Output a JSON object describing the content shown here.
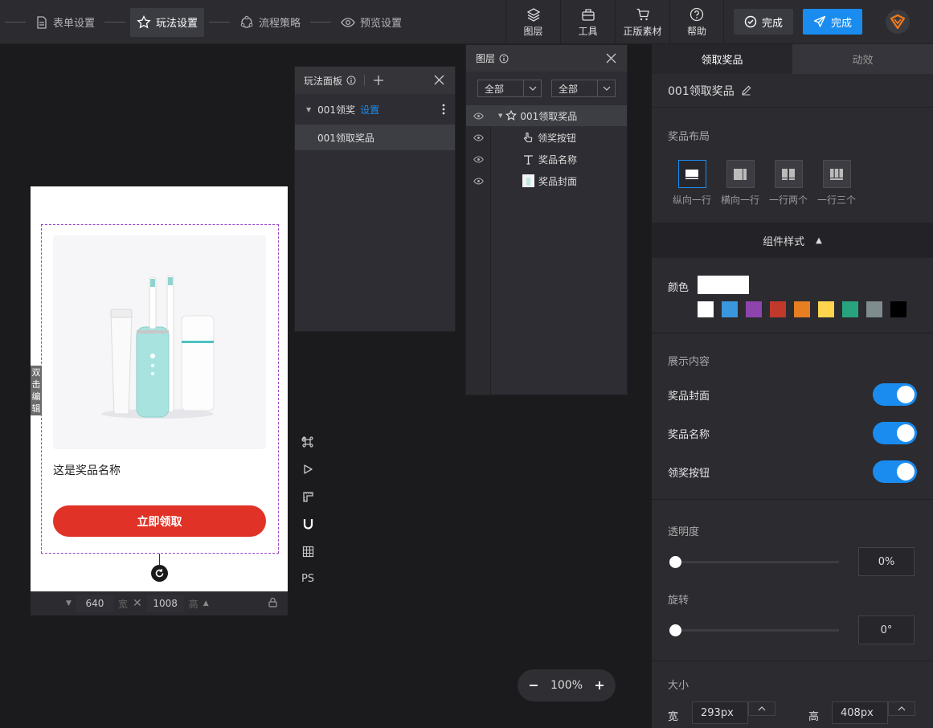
{
  "steps": [
    {
      "label": "表单设置",
      "icon": "document-icon"
    },
    {
      "label": "玩法设置",
      "icon": "star-gear-icon"
    },
    {
      "label": "流程策略",
      "icon": "flow-icon"
    },
    {
      "label": "预览设置",
      "icon": "eye-icon"
    }
  ],
  "tools": [
    {
      "label": "图层",
      "icon": "layers-icon"
    },
    {
      "label": "工具",
      "icon": "toolbox-icon"
    },
    {
      "label": "正版素材",
      "icon": "cart-icon"
    },
    {
      "label": "帮助",
      "icon": "help-icon"
    }
  ],
  "buttons": {
    "done_secondary": "完成",
    "done_primary": "完成"
  },
  "canvas": {
    "product_name": "这是奖品名称",
    "claim_button": "立即领取",
    "double_click_edit": "双击编辑",
    "width": "640",
    "width_unit": "宽",
    "height": "1008",
    "height_unit": "高"
  },
  "side_tools": [
    "command-icon",
    "play-icon",
    "ruler-icon",
    "magnet-icon",
    "grid-icon",
    "PS"
  ],
  "play_panel": {
    "title": "玩法面板",
    "group": "001领奖",
    "settings_link": "设置",
    "item": "001领取奖品"
  },
  "layers_panel": {
    "title": "图层",
    "filter1": "全部",
    "filter2": "全部",
    "rows": [
      {
        "label": "001领取奖品",
        "icon": "star-gear-icon"
      },
      {
        "label": "领奖按钮",
        "icon": "pointer-icon"
      },
      {
        "label": "奖品名称",
        "icon": "text-icon"
      },
      {
        "label": "奖品封面",
        "icon": "image-icon"
      }
    ]
  },
  "right_panel": {
    "tabs": [
      "领取奖品",
      "动效"
    ],
    "title": "001领取奖品",
    "layout_label": "奖品布局",
    "layouts": [
      "纵向一行",
      "横向一行",
      "一行两个",
      "一行三个"
    ],
    "style_section": "组件样式",
    "color_label": "颜色",
    "current_color": "#ffffff",
    "swatches": [
      "#ffffff",
      "#3a96dd",
      "#8e44ad",
      "#c0392b",
      "#e67e22",
      "#ffd54f",
      "#27a47e",
      "#7f8c8d",
      "#000000"
    ],
    "display_label": "展示内容",
    "toggles": [
      {
        "label": "奖品封面",
        "on": true
      },
      {
        "label": "奖品名称",
        "on": true
      },
      {
        "label": "领奖按钮",
        "on": true
      }
    ],
    "opacity_label": "透明度",
    "opacity_value": "0%",
    "rotate_label": "旋转",
    "rotate_value": "0°",
    "size_label": "大小",
    "width_label": "宽",
    "width_value": "293px",
    "height_label": "高",
    "height_value": "408px"
  },
  "zoom": {
    "value": "100%"
  }
}
